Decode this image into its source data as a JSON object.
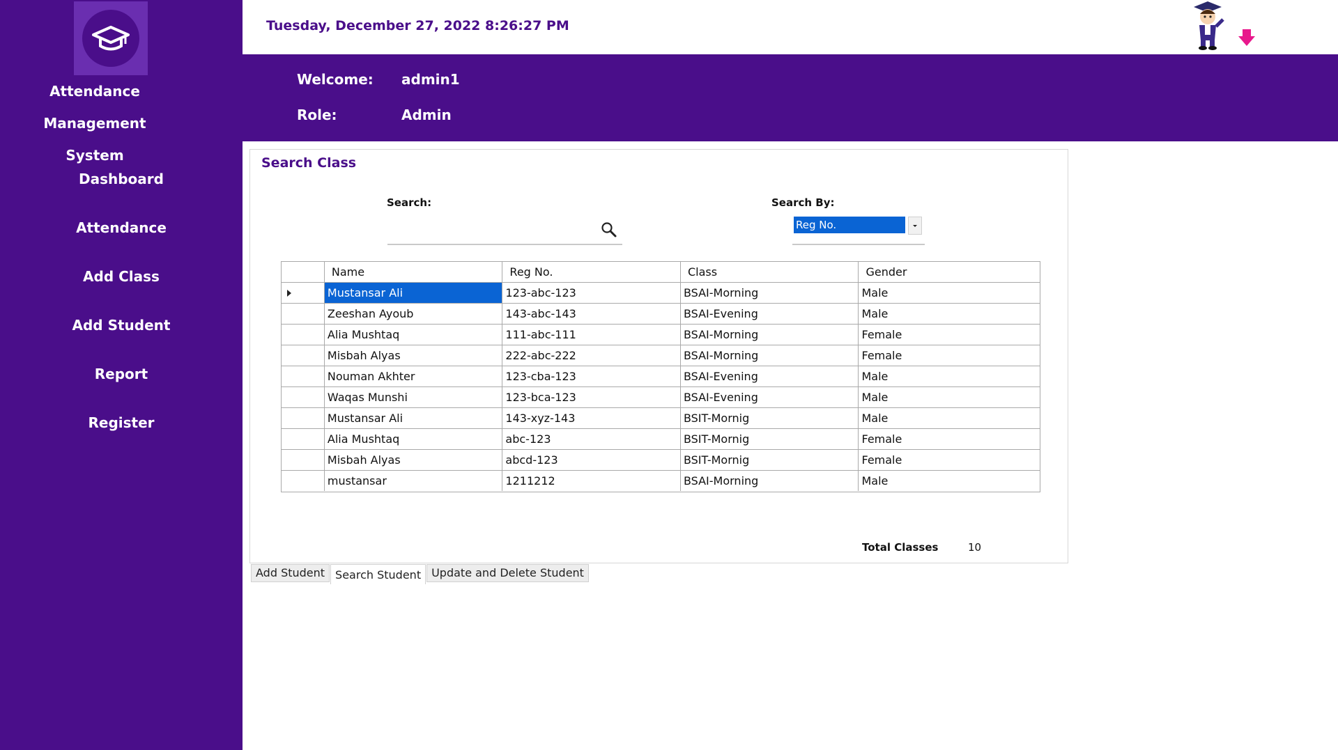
{
  "app": {
    "title_line1": "Attendance Management",
    "title_line2": "System"
  },
  "sidebar": {
    "items": [
      {
        "label": "Dashboard"
      },
      {
        "label": "Attendance"
      },
      {
        "label": "Add Class"
      },
      {
        "label": "Add Student"
      },
      {
        "label": "Report"
      },
      {
        "label": "Register"
      }
    ]
  },
  "header": {
    "datetime": "Tuesday, December 27, 2022 8:26:27 PM",
    "welcome_label": "Welcome:",
    "welcome_value": "admin1",
    "role_label": "Role:",
    "role_value": "Admin"
  },
  "panel": {
    "title": "Search Class",
    "search_label": "Search:",
    "search_value": "",
    "search_by_label": "Search By:",
    "search_by_value": "Reg No.",
    "total_label": "Total Classes",
    "total_value": "10"
  },
  "grid": {
    "columns": [
      "Name",
      "Reg No.",
      "Class",
      "Gender"
    ],
    "rows": [
      [
        "Mustansar Ali",
        "123-abc-123",
        "BSAI-Morning",
        "Male"
      ],
      [
        "Zeeshan Ayoub",
        "143-abc-143",
        "BSAI-Evening",
        "Male"
      ],
      [
        "Alia Mushtaq",
        "111-abc-111",
        "BSAI-Morning",
        "Female"
      ],
      [
        "Misbah Alyas",
        "222-abc-222",
        "BSAI-Morning",
        "Female"
      ],
      [
        "Nouman Akhter",
        "123-cba-123",
        "BSAI-Evening",
        "Male"
      ],
      [
        "Waqas Munshi",
        "123-bca-123",
        "BSAI-Evening",
        "Male"
      ],
      [
        "Mustansar Ali",
        "143-xyz-143",
        "BSIT-Mornig",
        "Male"
      ],
      [
        "Alia Mushtaq",
        "abc-123",
        "BSIT-Mornig",
        "Female"
      ],
      [
        "Misbah Alyas",
        "abcd-123",
        "BSIT-Mornig",
        "Female"
      ],
      [
        "mustansar",
        "1211212",
        "BSAI-Morning",
        "Male"
      ]
    ]
  },
  "tabs": [
    {
      "label": "Add Student"
    },
    {
      "label": "Search Student"
    },
    {
      "label": "Update and Delete Student"
    }
  ],
  "colors": {
    "brand": "#4a0e8a",
    "selection": "#0a64d4",
    "accent_arrow": "#e8188c"
  },
  "icons": {
    "logo": "graduation-cap-icon",
    "search": "magnifier-icon",
    "mascot": "graduate-mascot",
    "logout": "arrow-down-icon"
  }
}
